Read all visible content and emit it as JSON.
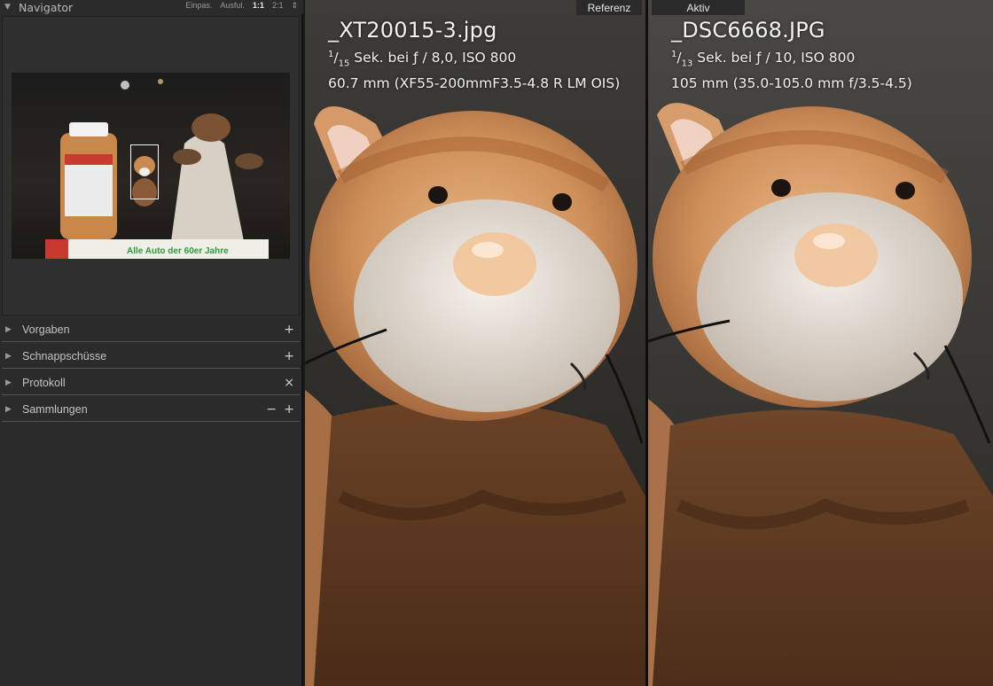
{
  "navigator": {
    "title": "Navigator",
    "zoom_options": [
      "Einpas.",
      "Ausful.",
      "1:1",
      "2:1"
    ],
    "zoom_selected": "1:1",
    "preview_text": "Alle Auto der 60er Jahre"
  },
  "panels": [
    {
      "label": "Vorgaben",
      "action": "+"
    },
    {
      "label": "Schnappschüsse",
      "action": "+"
    },
    {
      "label": "Protokoll",
      "action": "×"
    },
    {
      "label": "Sammlungen",
      "action_minus": "−",
      "action": "+"
    }
  ],
  "reference": {
    "tag": "Referenz",
    "filename": "_XT20015-3.jpg",
    "shutter_num": "1",
    "shutter_den": "15",
    "exposure_rest": " Sek. bei ƒ / 8,0, ISO 800",
    "lens": "60.7 mm (XF55-200mmF3.5-4.8 R LM OIS)"
  },
  "active": {
    "tag": "Aktiv",
    "filename": "_DSC6668.JPG",
    "shutter_num": "1",
    "shutter_den": "13",
    "exposure_rest": " Sek. bei ƒ / 10, ISO 800",
    "lens": "105 mm (35.0-105.0 mm f/3.5-4.5)"
  }
}
